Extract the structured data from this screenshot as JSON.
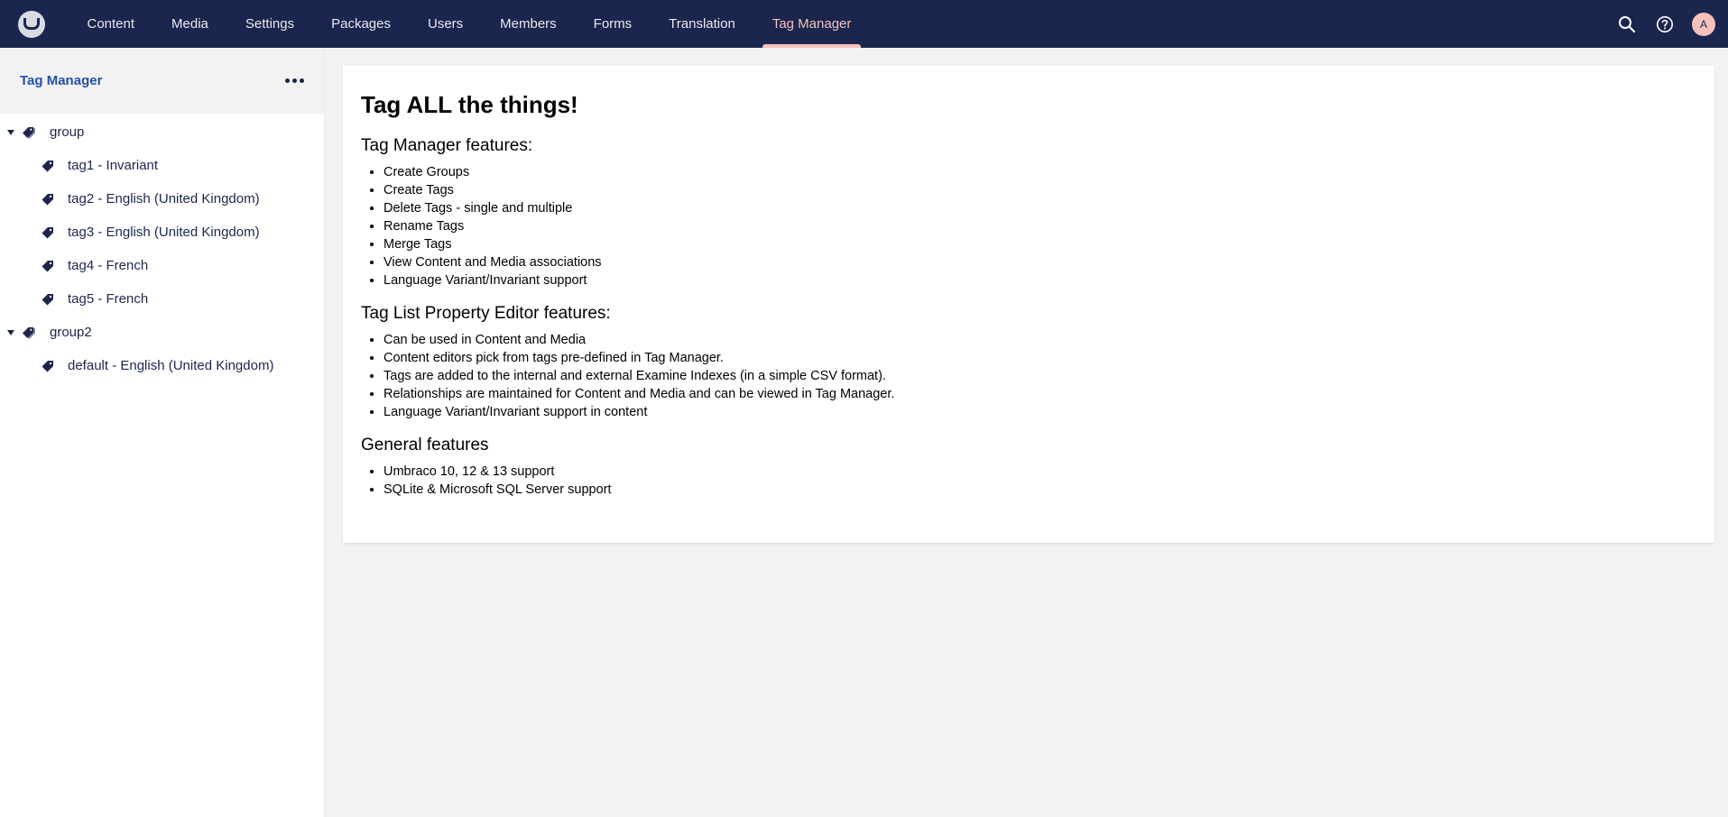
{
  "nav": {
    "items": [
      "Content",
      "Media",
      "Settings",
      "Packages",
      "Users",
      "Members",
      "Forms",
      "Translation",
      "Tag Manager"
    ],
    "active_index": 8
  },
  "top_actions": {
    "avatar_initial": "A"
  },
  "sidebar": {
    "title": "Tag Manager",
    "groups": [
      {
        "label": "group",
        "tags": [
          "tag1 - Invariant",
          "tag2 - English (United Kingdom)",
          "tag3 - English (United Kingdom)",
          "tag4 - French",
          "tag5 - French"
        ]
      },
      {
        "label": "group2",
        "tags": [
          "default - English (United Kingdom)"
        ]
      }
    ]
  },
  "main": {
    "heading": "Tag ALL the things!",
    "sections": [
      {
        "title": "Tag Manager features:",
        "items": [
          "Create Groups",
          "Create Tags",
          "Delete Tags - single and multiple",
          "Rename Tags",
          "Merge Tags",
          "View Content and Media associations",
          "Language Variant/Invariant support"
        ]
      },
      {
        "title": "Tag List Property Editor features:",
        "items": [
          "Can be used in Content and Media",
          "Content editors pick from tags pre-defined in Tag Manager.",
          "Tags are added to the internal and external Examine Indexes (in a simple CSV format).",
          "Relationships are maintained for Content and Media and can be viewed in Tag Manager.",
          "Language Variant/Invariant support in content"
        ]
      },
      {
        "title": "General features",
        "items": [
          "Umbraco 10, 12 & 13 support",
          "SQLite & Microsoft SQL Server support"
        ]
      }
    ]
  },
  "colors": {
    "header_bg": "#1b264f",
    "accent": "#f5c1bc",
    "link": "#2152a3",
    "page_bg": "#f3f2f3"
  },
  "icons": [
    "umbraco-logo-icon",
    "search-icon",
    "help-icon",
    "tags-icon",
    "tag-icon",
    "ellipsis-icon",
    "caret-down-icon"
  ]
}
